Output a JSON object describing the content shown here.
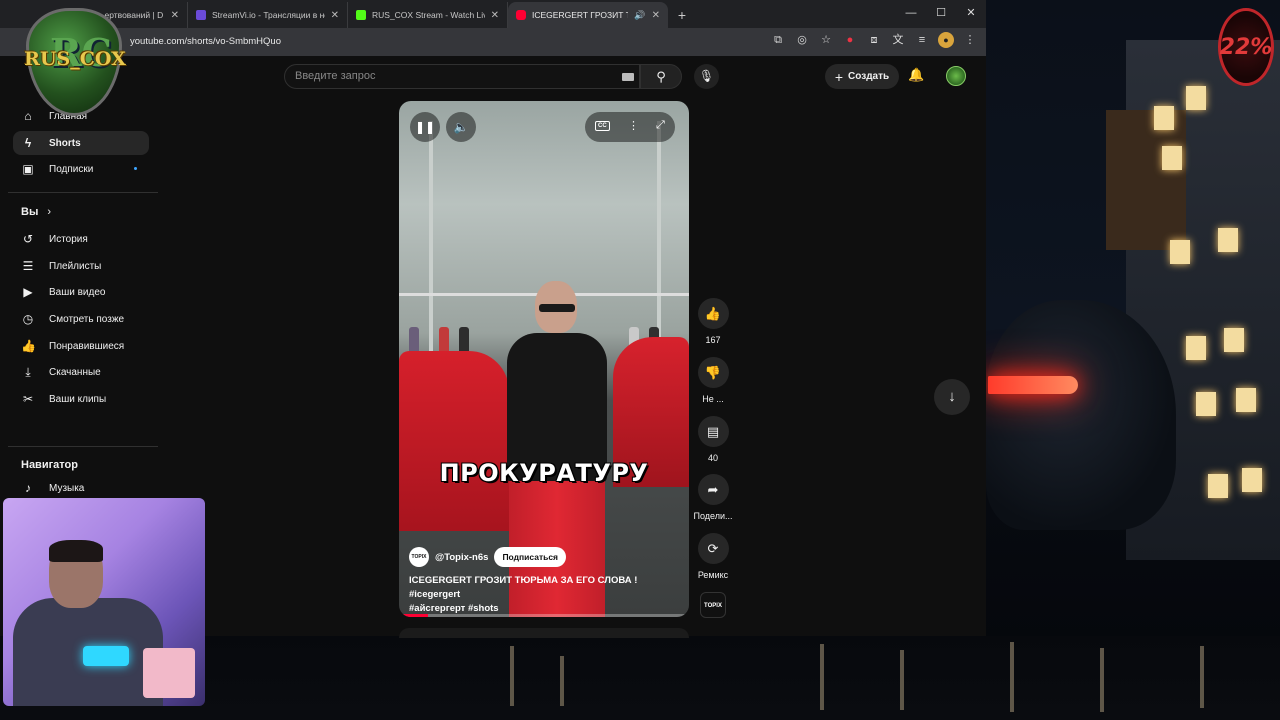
{
  "browser": {
    "tabs": [
      {
        "title": "…ертвований | D",
        "favicon_color": "#3c3c3c",
        "active": false
      },
      {
        "title": "StreamVi.io - Трансляции в не",
        "favicon_color": "#6b4bd8",
        "active": false
      },
      {
        "title": "RUS_COX Stream - Watch Live",
        "favicon_color": "#53fc18",
        "active": false
      },
      {
        "title": "ICEGERGERT ГРОЗИТ ТЮРЬ",
        "favicon_color": "#ff0033",
        "active": true
      }
    ],
    "new_tab": "+",
    "url": "youtube.com/shorts/vo-SmbmHQuo"
  },
  "overlay": {
    "logo_text": "RUS_COX",
    "logo_monogram": "RC",
    "percent": "22%"
  },
  "youtube": {
    "search_placeholder": "Введите запрос",
    "create_label": "Создать",
    "sidebar": {
      "top_items": [
        {
          "label": "Главная",
          "icon": "home-icon"
        },
        {
          "label": "Shorts",
          "icon": "shorts-icon",
          "active": true
        },
        {
          "label": "Подписки",
          "icon": "subscriptions-icon",
          "badge": true
        }
      ],
      "you_title": "Вы",
      "you_items": [
        {
          "label": "История",
          "icon": "history-icon"
        },
        {
          "label": "Плейлисты",
          "icon": "playlists-icon"
        },
        {
          "label": "Ваши видео",
          "icon": "your-videos-icon"
        },
        {
          "label": "Смотреть позже",
          "icon": "watch-later-icon"
        },
        {
          "label": "Понравившиеся",
          "icon": "liked-icon"
        },
        {
          "label": "Скачанные",
          "icon": "downloads-icon"
        },
        {
          "label": "Ваши клипы",
          "icon": "clips-icon"
        }
      ],
      "navigator_title": "Навигатор",
      "navigator_items": [
        {
          "label": "Музыка",
          "icon": "music-icon"
        }
      ]
    },
    "short": {
      "caption_overlay": "ПРОКУРАТУРУ",
      "channel_handle": "@Topix-n6s",
      "channel_logo_text": "TOPIX",
      "subscribe_label": "Подписаться",
      "title_line1": "ICEGERGERT ГРОЗИТ ТЮРЬМА ЗА ЕГО СЛОВА ! #icegergert",
      "title_line2": "#айсгергерт #shots",
      "progress": 0.1,
      "cc_label": "CC"
    },
    "actions": [
      {
        "name": "like",
        "icon": "thumbs-up-icon",
        "label": "167"
      },
      {
        "name": "dislike",
        "icon": "thumbs-down-icon",
        "label": "Не ..."
      },
      {
        "name": "comments",
        "icon": "comment-icon",
        "label": "40"
      },
      {
        "name": "share",
        "icon": "share-icon",
        "label": "Подели..."
      },
      {
        "name": "remix",
        "icon": "remix-icon",
        "label": "Ремикс"
      }
    ]
  }
}
